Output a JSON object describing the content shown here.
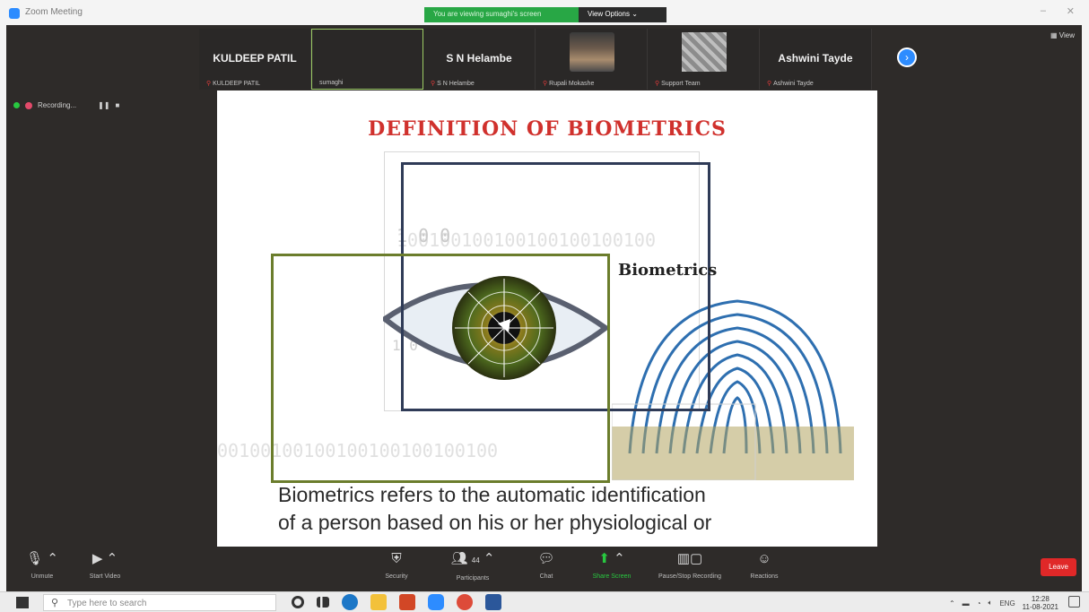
{
  "window": {
    "title": "Zoom Meeting",
    "banner_text": "You are viewing sumaghi's screen",
    "view_options": "View Options ⌄",
    "view_label": "View"
  },
  "participants": [
    {
      "name": "KULDEEP PATIL",
      "sub": "KULDEEP PATIL",
      "display": "name"
    },
    {
      "name": "",
      "sub": "sumaghi",
      "display": "highlight"
    },
    {
      "name": "S N Helambe",
      "sub": "S N Helambe",
      "display": "name"
    },
    {
      "name": "",
      "sub": "Rupali Mokashe",
      "display": "photo"
    },
    {
      "name": "",
      "sub": "Support Team",
      "display": "pattern"
    },
    {
      "name": "Ashwini Tayde",
      "sub": "Ashwini Tayde",
      "display": "name"
    }
  ],
  "recording": {
    "label": "Recording..."
  },
  "slide": {
    "title": "DEFINITION OF BIOMETRICS",
    "image_label": "Biometrics",
    "binary_top": "100100100100100100100100",
    "binary_bottom": "00100100100100100100100100",
    "binary_mid": "1 0 0 1 0 0 1",
    "binary_left": "1 0 0",
    "body_line1": "Biometrics refers to the automatic identification",
    "body_line2": "of a person based on his or her physiological or"
  },
  "toolbar": {
    "unmute": "Unmute",
    "start_video": "Start Video",
    "security": "Security",
    "participants": "Participants",
    "participants_count": "44",
    "chat": "Chat",
    "share_screen": "Share Screen",
    "pause_recording": "Pause/Stop Recording",
    "reactions": "Reactions",
    "leave": "Leave"
  },
  "taskbar": {
    "search_placeholder": "Type here to search",
    "language": "ENG",
    "time": "12:28",
    "date": "11-08-2021"
  },
  "colors": {
    "slide_title": "#d0312d",
    "banner_green": "#28a745",
    "leave": "#e02828",
    "accent_blue": "#2d8cff"
  }
}
